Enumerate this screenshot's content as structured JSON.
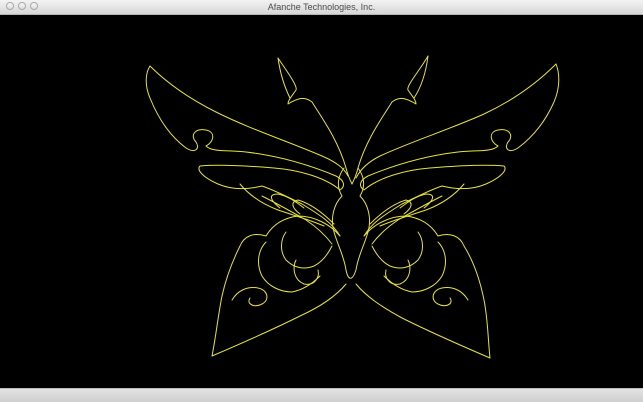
{
  "window": {
    "title": "Afanche Technologies, Inc.",
    "controls": [
      "close-button",
      "minimize-button",
      "zoom-button"
    ]
  },
  "canvas": {
    "background": "#000000",
    "stroke_color": "#e8e23a",
    "artwork": "butterfly-outline"
  }
}
